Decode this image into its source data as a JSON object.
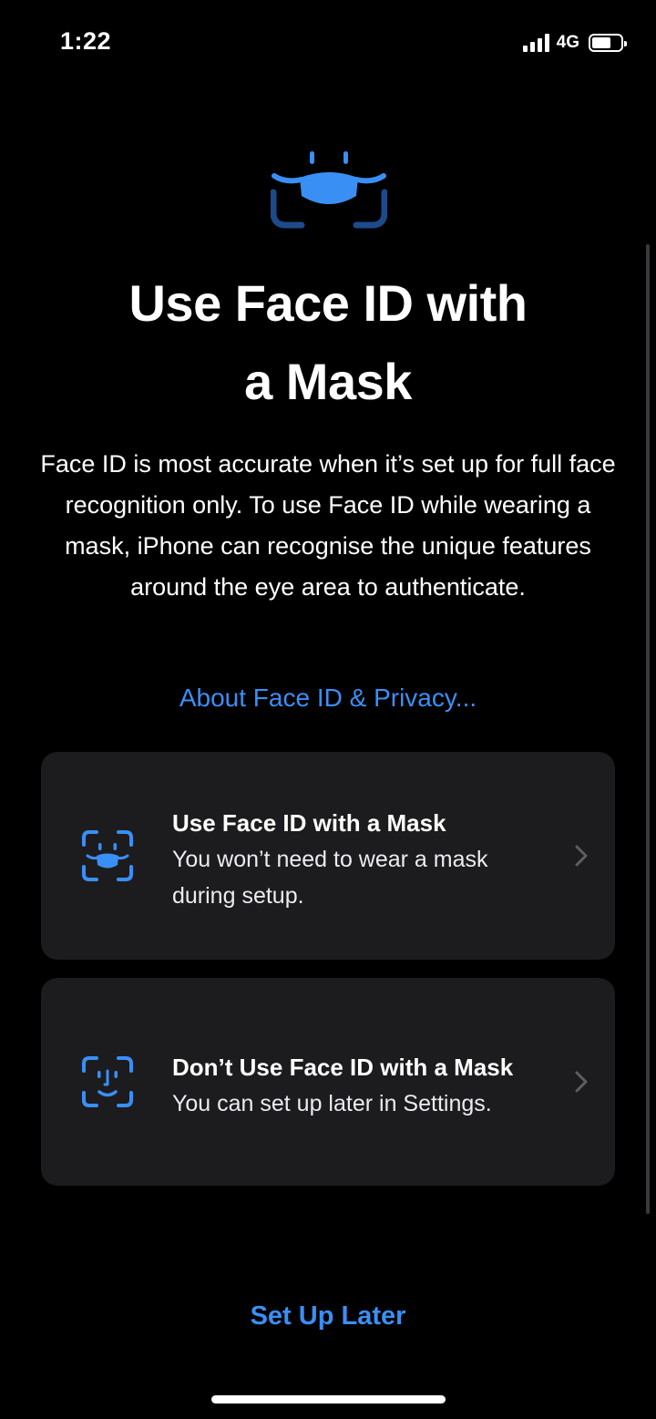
{
  "status_bar": {
    "time": "1:22",
    "network": "4G"
  },
  "hero": {
    "icon": "face-id-mask-icon",
    "title_line1": "Use Face ID with",
    "title_line2": "a Mask"
  },
  "description": "Face ID is most accurate when it’s set up for full face recognition only. To use Face ID while wearing a mask, iPhone can recognise the unique features around the eye area to authenticate.",
  "privacy_link": "About Face ID & Privacy...",
  "options": [
    {
      "title": "Use Face ID with a Mask",
      "subtitle_line1": "You won’t need to wear a mask",
      "subtitle_line2": "during setup.",
      "icon": "face-id-mask-icon"
    },
    {
      "title": "Don’t Use Face ID with a Mask",
      "subtitle_line1": "You can set up later in Settings.",
      "icon": "face-id-icon"
    }
  ],
  "setup_later": "Set Up Later",
  "colors": {
    "accent": "#3a8ff5",
    "card": "#1c1c1e",
    "background": "#000000"
  }
}
